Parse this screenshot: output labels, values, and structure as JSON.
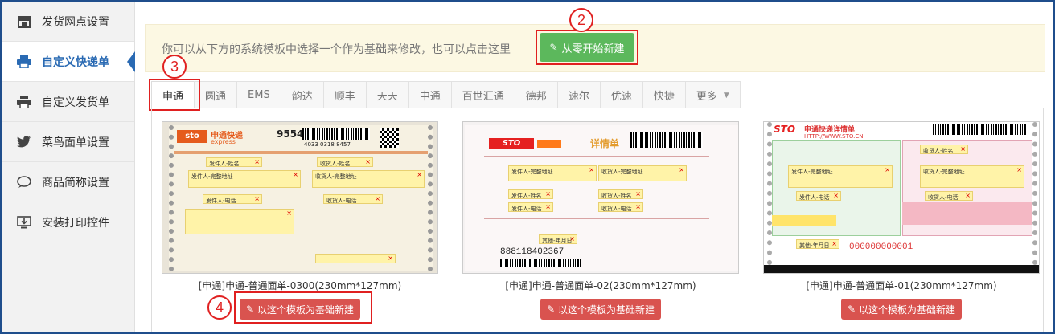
{
  "sidebar": {
    "items": [
      {
        "label": "发货网点设置",
        "icon": "store-icon",
        "active": false
      },
      {
        "label": "自定义快递单",
        "icon": "printer-icon",
        "active": true
      },
      {
        "label": "自定义发货单",
        "icon": "printer-icon",
        "active": false
      },
      {
        "label": "菜鸟面单设置",
        "icon": "bird-icon",
        "active": false
      },
      {
        "label": "商品简称设置",
        "icon": "chat-bubble-icon",
        "active": false
      },
      {
        "label": "安装打印控件",
        "icon": "download-icon",
        "active": false
      }
    ]
  },
  "hint": {
    "text": "你可以从下方的系统模板中选择一个作为基础来修改，也可以点击这里",
    "button": "从零开始新建"
  },
  "annotations": [
    "2",
    "3",
    "4"
  ],
  "tabs": [
    {
      "label": "申通",
      "active": true
    },
    {
      "label": "圆通"
    },
    {
      "label": "EMS"
    },
    {
      "label": "韵达"
    },
    {
      "label": "顺丰"
    },
    {
      "label": "天天"
    },
    {
      "label": "中通"
    },
    {
      "label": "百世汇通"
    },
    {
      "label": "德邦"
    },
    {
      "label": "速尔"
    },
    {
      "label": "优速"
    },
    {
      "label": "快捷"
    },
    {
      "label": "更多"
    }
  ],
  "templates": [
    {
      "title": "[申通]申通-普通面单-0300(230mm*127mm)",
      "button": "以这个模板为基础新建",
      "logo": "申通快递",
      "logo_sub": "express",
      "number": "95543",
      "barcode_text": "4033 0318 8457",
      "fields": [
        "发件人-姓名",
        "收货人-姓名",
        "发件人-完整地址",
        "收货人-完整地址",
        "发件人-电话",
        "收货人-电话"
      ]
    },
    {
      "title": "[申通]申通-普通面单-02(230mm*127mm)",
      "button": "以这个模板为基础新建",
      "logo": "STO",
      "logo_sub": "详情单",
      "barcode_text": "888118402367",
      "fields": [
        "发件人-完整地址",
        "收货人-完整地址",
        "发件人-姓名",
        "收货人-姓名",
        "发件人-电话",
        "收货人-电话",
        "其他-年月日"
      ]
    },
    {
      "title": "[申通]申通-普通面单-01(230mm*127mm)",
      "button": "以这个模板为基础新建",
      "logo": "STO",
      "logo_sub": "申通快递详情单",
      "site": "HTTP://WWW.STO.CN",
      "barcode_text": "000000000001",
      "fields": [
        "收货人-姓名",
        "发件人-完整地址",
        "收货人-完整地址",
        "发件人-电话",
        "收货人-电话",
        "其他-年月日"
      ]
    }
  ],
  "colors": {
    "accent": "#2a6ab3",
    "green_button": "#5cb85c",
    "red_button": "#d9534f",
    "highlight": "#e02020",
    "hint_bg": "#fcf8e3"
  }
}
